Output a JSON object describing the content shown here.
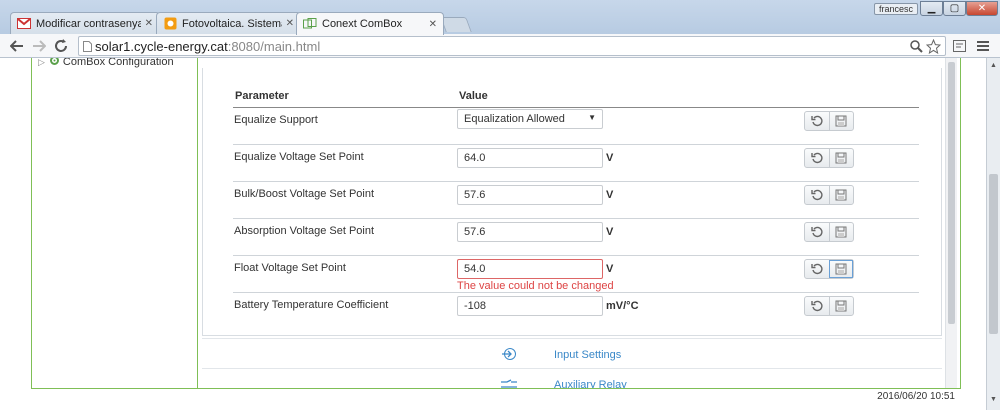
{
  "browser": {
    "tabs": [
      {
        "title": "Modificar contrasenya en",
        "icon": "gmail-icon"
      },
      {
        "title": "Fotovoltaica. Sistemas ais",
        "icon": "blog-icon"
      },
      {
        "title": "Conext ComBox",
        "icon": "conext-icon",
        "active": true
      }
    ],
    "user": "francesc",
    "url": {
      "host": "solar1.cycle-energy.cat",
      "rest": ":8080/main.html"
    }
  },
  "nav": {
    "item": "ComBox Configuration"
  },
  "table": {
    "header_param": "Parameter",
    "header_value": "Value",
    "rows": [
      {
        "name": "Equalize Support",
        "type": "select",
        "value": "Equalization Allowed",
        "unit": ""
      },
      {
        "name": "Equalize Voltage Set Point",
        "type": "input",
        "value": "64.0",
        "unit": "V"
      },
      {
        "name": "Bulk/Boost Voltage Set Point",
        "type": "input",
        "value": "57.6",
        "unit": "V"
      },
      {
        "name": "Absorption Voltage Set Point",
        "type": "input",
        "value": "57.6",
        "unit": "V"
      },
      {
        "name": "Float Voltage Set Point",
        "type": "input",
        "value": "54.0",
        "unit": "V",
        "error": "The value could not be changed"
      },
      {
        "name": "Battery Temperature Coefficient",
        "type": "input",
        "value": "-108",
        "unit": "mV/°C"
      }
    ]
  },
  "sections": [
    {
      "label": "Input Settings",
      "icon": "input-arrow-icon"
    },
    {
      "label": "Auxiliary Relay",
      "icon": "relay-icon"
    }
  ],
  "status": {
    "datetime": "2016/06/20 10:51"
  },
  "colors": {
    "accent_green": "#7fbf56",
    "link_blue": "#3a88c8",
    "error_red": "#d44444"
  }
}
